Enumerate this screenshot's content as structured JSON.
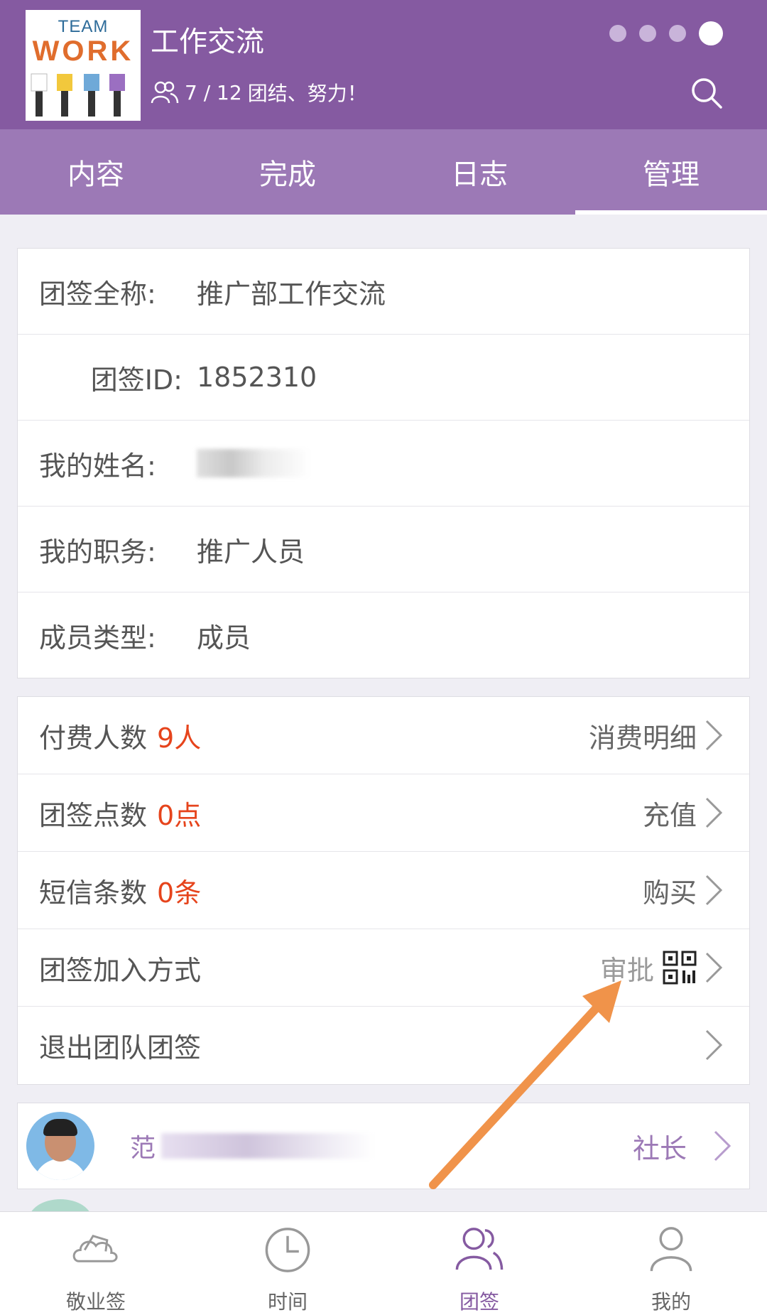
{
  "header": {
    "logo_top": "TEAM",
    "logo_main": "WORK",
    "title": "工作交流",
    "member_count": "7 / 12",
    "slogan": "团结、努力！",
    "page_dots": 4,
    "active_dot": 4
  },
  "tabs": [
    {
      "label": "内容",
      "active": false
    },
    {
      "label": "完成",
      "active": false
    },
    {
      "label": "日志",
      "active": false
    },
    {
      "label": "管理",
      "active": true
    }
  ],
  "info": {
    "full_name_label": "团签全称:",
    "full_name_value": "推广部工作交流",
    "id_label": "团签ID:",
    "id_value": "1852310",
    "my_name_label": "我的姓名:",
    "my_title_label": "我的职务:",
    "my_title_value": "推广人员",
    "member_type_label": "成员类型:",
    "member_type_value": "成员"
  },
  "actions": {
    "paid_label": "付费人数",
    "paid_value": "9人",
    "paid_link": "消费明细",
    "points_label": "团签点数",
    "points_value": "0点",
    "points_link": "充值",
    "sms_label": "短信条数",
    "sms_value": "0条",
    "sms_link": "购买",
    "join_label": "团签加入方式",
    "join_value": "审批",
    "quit_label": "退出团队团签"
  },
  "member": {
    "name_prefix": "范",
    "role": "社长"
  },
  "bottom_nav": [
    {
      "label": "敬业签",
      "icon": "cloud-note-icon",
      "active": false
    },
    {
      "label": "时间",
      "icon": "clock-icon",
      "active": false
    },
    {
      "label": "团签",
      "icon": "team-icon",
      "active": true
    },
    {
      "label": "我的",
      "icon": "user-icon",
      "active": false
    }
  ],
  "colors": {
    "header": "#855aa1",
    "tabs": "#9c79b6",
    "highlight_number": "#e6441c",
    "annotation_arrow": "#f0934a"
  }
}
